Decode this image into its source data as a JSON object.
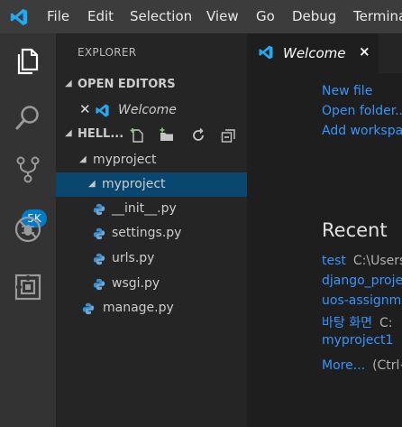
{
  "menu": {
    "items": [
      "File",
      "Edit",
      "Selection",
      "View",
      "Go",
      "Debug",
      "Terminal"
    ]
  },
  "activity": {
    "scm_badge": "5K"
  },
  "explorer": {
    "title": "EXPLORER",
    "open_editors_label": "OPEN EDITORS",
    "open_editor_item": "Welcome",
    "workspace_label": "HELL...",
    "tree": [
      {
        "label": "myproject",
        "level": 0,
        "type": "folder",
        "expanded": true
      },
      {
        "label": "myproject",
        "level": 1,
        "type": "folder",
        "expanded": true,
        "selected": true
      },
      {
        "label": "__init__.py",
        "level": 2,
        "type": "python"
      },
      {
        "label": "settings.py",
        "level": 2,
        "type": "python"
      },
      {
        "label": "urls.py",
        "level": 2,
        "type": "python"
      },
      {
        "label": "wsgi.py",
        "level": 2,
        "type": "python"
      },
      {
        "label": "manage.py",
        "level": 1,
        "type": "python"
      }
    ]
  },
  "tab": {
    "label": "Welcome",
    "close": "×"
  },
  "welcome": {
    "start_links": [
      "New file",
      "Open folder...",
      "Add workspace..."
    ],
    "recent_title": "Recent",
    "recent": [
      {
        "name": "test",
        "path": "C:\\Users"
      },
      {
        "name": "django_project",
        "path": ""
      },
      {
        "name": "uos-assignment",
        "path": ""
      },
      {
        "name": "바탕 화면",
        "path": "C:"
      },
      {
        "name": "myproject1",
        "path": ""
      }
    ],
    "more_label": "More...",
    "more_hint": "(Ctrl+R)"
  },
  "colors": {
    "accent": "#007acc",
    "link": "#3794ff",
    "selection": "#094771"
  }
}
